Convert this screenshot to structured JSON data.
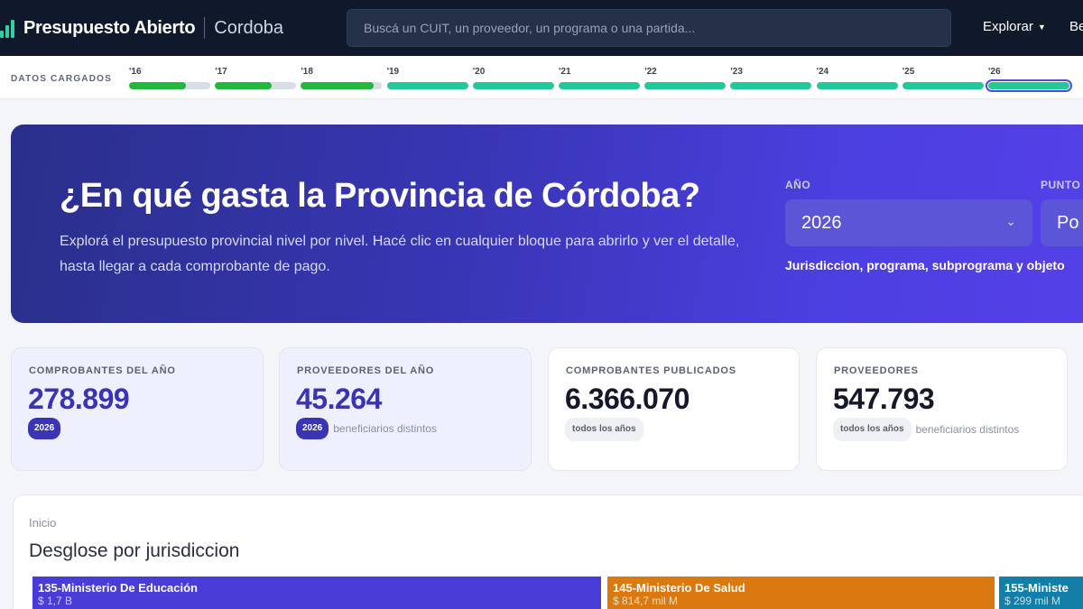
{
  "header": {
    "brand": "Presupuesto Abierto",
    "subbrand": "Cordoba",
    "search_placeholder": "Buscá un CUIT, un proveedor, un programa o una partida...",
    "nav_explore": "Explorar",
    "nav_more": "Be"
  },
  "datos": {
    "label": "DATOS CARGADOS",
    "years": [
      {
        "label": "'16",
        "fill": 0.7,
        "color": "#22b83a"
      },
      {
        "label": "'17",
        "fill": 0.7,
        "color": "#22b83a"
      },
      {
        "label": "'18",
        "fill": 0.9,
        "color": "#22b83a"
      },
      {
        "label": "'19",
        "fill": 1.0,
        "color": "#20c997"
      },
      {
        "label": "'20",
        "fill": 1.0,
        "color": "#20c997"
      },
      {
        "label": "'21",
        "fill": 1.0,
        "color": "#20c997"
      },
      {
        "label": "'22",
        "fill": 1.0,
        "color": "#20c997"
      },
      {
        "label": "'23",
        "fill": 1.0,
        "color": "#20c997"
      },
      {
        "label": "'24",
        "fill": 1.0,
        "color": "#20c997"
      },
      {
        "label": "'25",
        "fill": 1.0,
        "color": "#20c997"
      },
      {
        "label": "'26",
        "fill": 1.0,
        "color": "#20c997",
        "current": true
      }
    ]
  },
  "hero": {
    "title": "¿En qué gasta la Provincia de Córdoba?",
    "description": "Explorá el presupuesto provincial nivel por nivel. Hacé clic en cualquier bloque para abrirlo y ver el detalle, hasta llegar a cada comprobante de pago.",
    "year_label": "AÑO",
    "year_value": "2026",
    "punto_label": "PUNTO",
    "punto_value": "Po",
    "hint": "Jurisdiccion, programa, subprograma y objeto"
  },
  "stats": [
    {
      "label": "COMPROBANTES DEL AÑO",
      "value": "278.899",
      "pill": "2026",
      "note": ""
    },
    {
      "label": "PROVEEDORES DEL AÑO",
      "value": "45.264",
      "pill": "2026",
      "note": "beneficiarios distintos"
    },
    {
      "label": "COMPROBANTES PUBLICADOS",
      "value": "6.366.070",
      "pill": "todos los años",
      "note": ""
    },
    {
      "label": "PROVEEDORES",
      "value": "547.793",
      "pill": "todos los años",
      "note": "beneficiarios distintos"
    }
  ],
  "breakdown": {
    "breadcrumb": "Inicio",
    "title": "Desglose por jurisdiccion",
    "tiles": [
      {
        "name": "135-Ministerio De Educación",
        "amount": "$ 1,7 B",
        "color": "#4a3cd6"
      },
      {
        "name": "145-Ministerio De Salud",
        "amount": "$ 814,7 mil M",
        "color": "#d9790f"
      },
      {
        "name": "155-Ministe",
        "amount": "$ 299 mil M",
        "color": "#117fa8"
      }
    ]
  },
  "colors": {
    "nav_bg": "#10192b",
    "accent": "#4b3fe0",
    "green": "#22b83a",
    "teal": "#20c997"
  }
}
